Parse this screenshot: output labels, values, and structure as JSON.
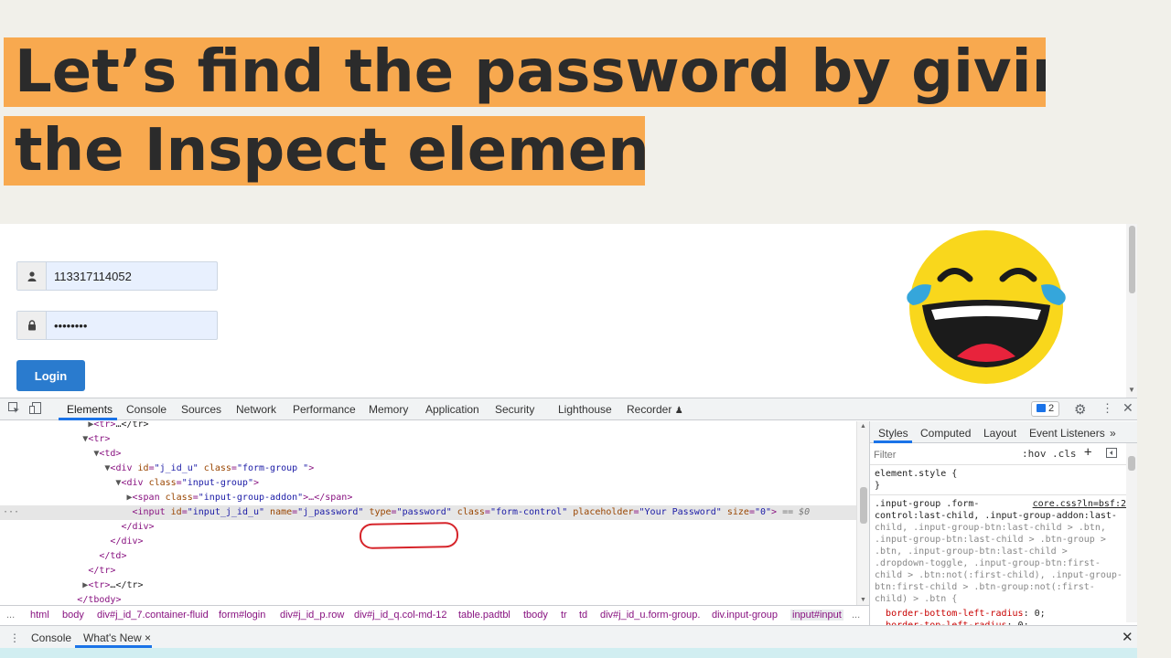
{
  "title": {
    "line1": "Let’s find the password by giving",
    "line2": "the Inspect element"
  },
  "login_form": {
    "username_value": "113317114052",
    "password_value": "password",
    "login_label": "Login",
    "user_icon": "user-icon",
    "lock_icon": "lock-icon"
  },
  "emoji": {
    "name": "laughing-tears-emoji",
    "face_color": "#f9d71c",
    "tear_color": "#35a6db"
  },
  "devtools": {
    "tabs": [
      "Elements",
      "Console",
      "Sources",
      "Network",
      "Performance",
      "Memory",
      "Application",
      "Security",
      "Lighthouse",
      "Recorder"
    ],
    "active_tab": "Elements",
    "message_count": "2",
    "dom": {
      "l1_tag": "<tr>",
      "l1_rest": "…</tr>",
      "l2": "<tr>",
      "l3": "<td>",
      "l4_tag": "<div ",
      "l4_attr1": "id",
      "l4_val1": "\"j_id_u\"",
      "l4_attr2": " class",
      "l4_val2": "\"form-group \"",
      "l4_end": ">",
      "l5_tag": "<div ",
      "l5_attr": "class",
      "l5_val": "\"input-group\"",
      "l5_end": ">",
      "l6_tag": "<span ",
      "l6_attr": "class",
      "l6_val": "\"input-group-addon\"",
      "l6_end": ">…</span>",
      "l7_tag": "<input ",
      "l7_a1": "id",
      "l7_v1": "\"input_j_id_u\"",
      "l7_a2": " name",
      "l7_v2": "\"j_password\"",
      "l7_a3": " type",
      "l7_v3": "\"password\"",
      "l7_a4": " class",
      "l7_v4": "\"form-control\"",
      "l7_a5": " placeholder",
      "l7_v5": "\"Your Password\"",
      "l7_a6": " size",
      "l7_v6": "\"0\"",
      "l7_end": ">",
      "l7_suffix": " == $0",
      "l8": "</div>",
      "l9": "</div>",
      "l10": "</td>",
      "l11": "</tr>",
      "l12_tag": "<tr>",
      "l12_rest": "…</tr>",
      "l13": "</tbody>"
    },
    "styles": {
      "tabs": [
        "Styles",
        "Computed",
        "Layout",
        "Event Listeners"
      ],
      "filter_placeholder": "Filter",
      "hov": ":hov",
      "cls": ".cls",
      "element_style": "element.style {",
      "close_brace": "}",
      "source": "core.css?ln=bsf:2",
      "rule_lines": [
        ".input-group .form-",
        "control:last-child, .input-group-addon:last-",
        "child, .input-group-btn:last-child > .btn,",
        ".input-group-btn:last-child > .btn-group >",
        ".btn, .input-group-btn:last-child >",
        ".dropdown-toggle, .input-group-btn:first-",
        "child > .btn:not(:first-child), .input-group-",
        "btn:first-child > .btn-group:not(:first-",
        "child) > .btn {"
      ],
      "prop1_name": "border-bottom-left-radius",
      "prop1_value": "0;",
      "prop2_name": "border-top-left-radius",
      "prop2_value": "0;"
    },
    "breadcrumb": [
      "...",
      "html",
      "body",
      "div#j_id_7.container-fluid",
      "form#login",
      "div#j_id_p.row",
      "div#j_id_q.col-md-12",
      "table.padtbl",
      "tbody",
      "tr",
      "td",
      "div#j_id_u.form-group.",
      "div.input-group",
      "input#input",
      "..."
    ],
    "drawer": {
      "tab1": "Console",
      "tab2": "What's New",
      "close": "×"
    }
  }
}
